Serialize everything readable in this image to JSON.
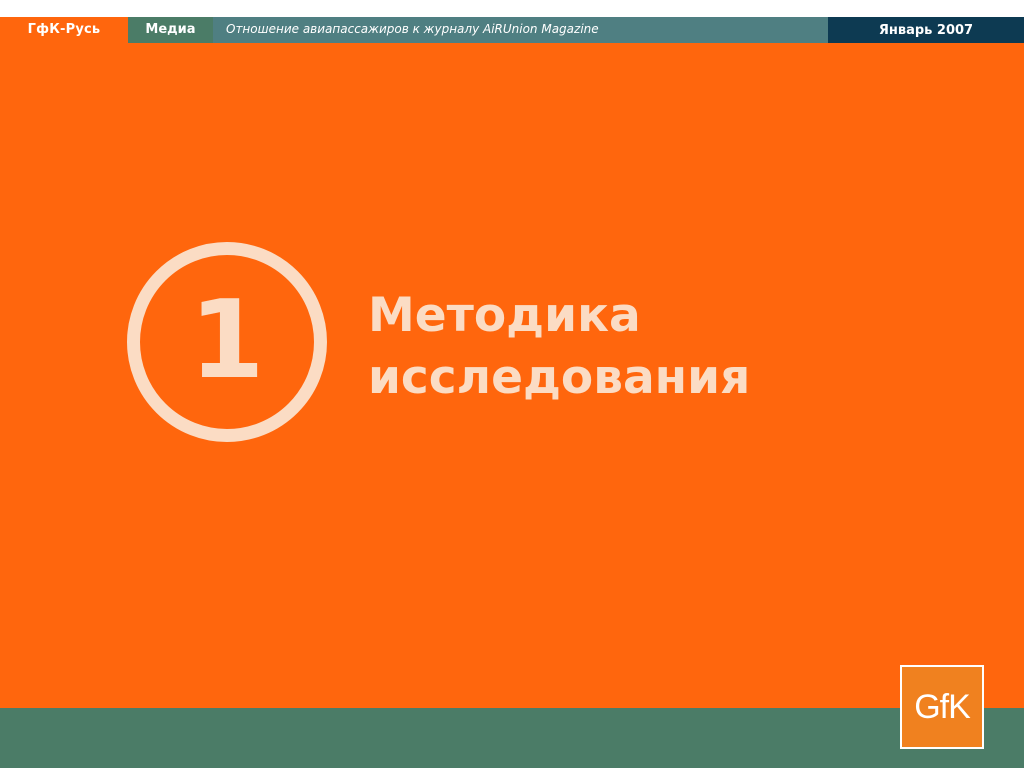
{
  "header": {
    "brand": "ГфК-Русь",
    "section": "Медиа",
    "title": "Отношение авиапассажиров к журналу AiRUnion Magazine",
    "date": "Январь 2007"
  },
  "main": {
    "section_number": "1",
    "title_line1": "Методика",
    "title_line2": "исследования"
  },
  "footer": {
    "logo_text": "GfK"
  },
  "colors": {
    "background": "#ff660d",
    "accent_green": "#4b7c67",
    "title_bar": "#4f7f82",
    "date_bar": "#0d3a52",
    "title_text": "#fbdcc4",
    "logo_orange": "#f0811f"
  }
}
